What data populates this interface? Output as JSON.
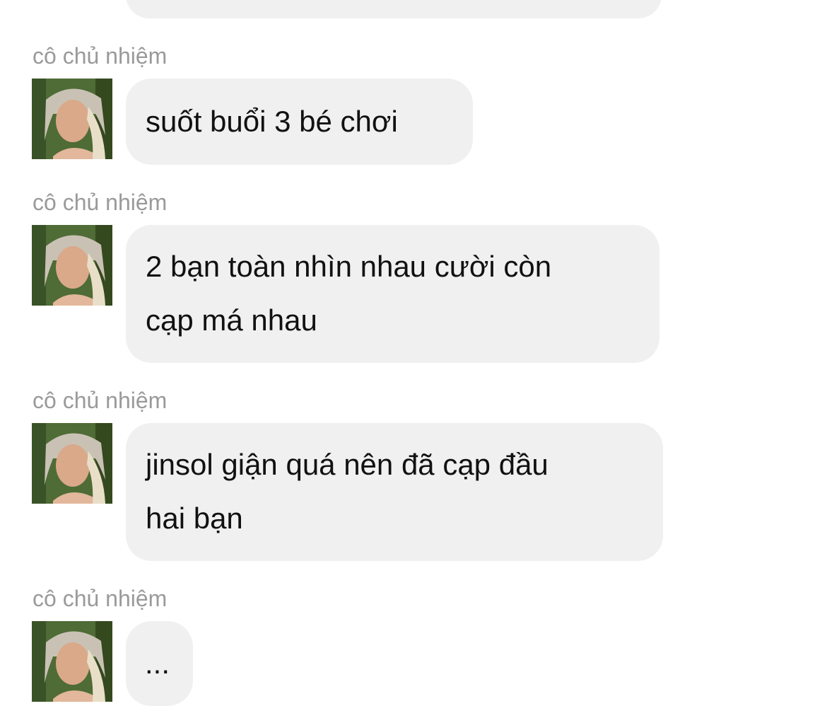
{
  "messages": [
    {
      "sender": "",
      "lines": []
    },
    {
      "sender": "cô chủ nhiệm",
      "lines": [
        "suốt buổi 3 bé chơi"
      ]
    },
    {
      "sender": "cô chủ nhiệm",
      "lines": [
        "2 bạn toàn nhìn nhau cười còn",
        "cạp má nhau"
      ]
    },
    {
      "sender": "cô chủ nhiệm",
      "lines": [
        "jinsol giận quá nên đã cạp đầu",
        "hai bạn"
      ]
    },
    {
      "sender": "cô chủ nhiệm",
      "lines": [
        "..."
      ]
    }
  ],
  "colors": {
    "bubble": "#f0f0f0",
    "sender_text": "#9a9a9a",
    "message_text": "#111111",
    "background": "#ffffff"
  },
  "icons": {
    "avatar": "profile-photo"
  }
}
